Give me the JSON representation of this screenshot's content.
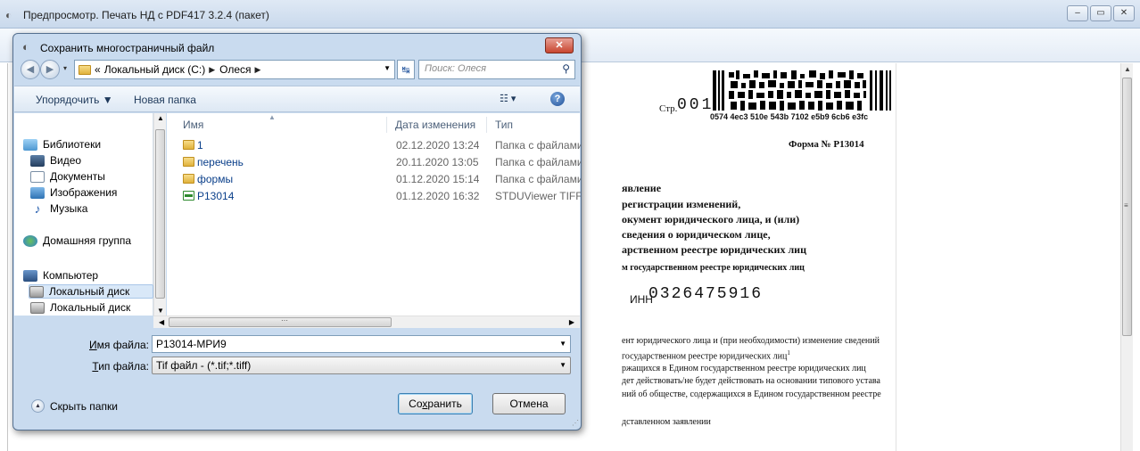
{
  "window": {
    "title": "Предпросмотр. Печать НД с PDF417 3.2.4 (пакет)",
    "minimize": "–",
    "maximize": "▭",
    "close": "✕"
  },
  "document": {
    "page_label": "Стр.",
    "page_number": "001",
    "barcode_text": "0574 4ec3 510e 543b 7102 e5b9 6cb6 e3fc",
    "form_number": "Форма № Р13014",
    "heading_lines": [
      "явление",
      "регистрации изменений,",
      "окумент юридического лица, и (или)",
      "сведения о юридическом лице,",
      "арственном реестре юридических лиц"
    ],
    "subheading": "м государственном реестре юридических лиц",
    "inn_label": "ИНН",
    "inn_value": "0326475916",
    "body_lines": [
      "ент  юридического лица и (при необходимости) изменение сведений",
      "государственном реестре юридических лиц",
      "ржащихся в Едином государственном реестре юридических лиц",
      "дет действовать/не будет действовать на основании типового устава",
      "ний об обществе, содержащихся в Едином государственном реестре",
      "дставленном заявлении"
    ],
    "footnote_mark": "1"
  },
  "dialog": {
    "title": "Сохранить многостраничный файл",
    "close": "✕",
    "nav": {
      "back": "◀",
      "forward": "▶",
      "breadcrumb_prefix": "«",
      "breadcrumbs": [
        "Локальный диск (C:)",
        "Олеся"
      ],
      "search_placeholder": "Поиск: Олеся"
    },
    "toolbar": {
      "organize": "Упорядочить ▼",
      "new_folder": "Новая папка",
      "view": "☷ ▾",
      "help": "?"
    },
    "nav_pane": {
      "items": [
        {
          "label": "Библиотеки",
          "icon": "library-icon"
        },
        {
          "label": "Видео",
          "icon": "video-icon"
        },
        {
          "label": "Документы",
          "icon": "documents-icon"
        },
        {
          "label": "Изображения",
          "icon": "images-icon"
        },
        {
          "label": "Музыка",
          "icon": "music-icon"
        },
        {
          "label": "Домашняя группа",
          "icon": "homegroup-icon"
        },
        {
          "label": "Компьютер",
          "icon": "computer-icon"
        },
        {
          "label": "Локальный диск",
          "icon": "disk-icon"
        },
        {
          "label": "Локальный диск",
          "icon": "disk-icon"
        }
      ]
    },
    "columns": {
      "name": "Имя",
      "date": "Дата изменения",
      "type": "Тип"
    },
    "files": [
      {
        "name": "1",
        "date": "02.12.2020 13:24",
        "type": "Папка с файлами",
        "icon": "folder-icon"
      },
      {
        "name": "перечень",
        "date": "20.11.2020 13:05",
        "type": "Папка с файлами",
        "icon": "folder-icon"
      },
      {
        "name": "формы",
        "date": "01.12.2020 15:14",
        "type": "Папка с файлами",
        "icon": "folder-icon"
      },
      {
        "name": "P13014",
        "date": "01.12.2020 16:32",
        "type": "STDUViewer TIFF ...",
        "icon": "tiff-file-icon"
      }
    ],
    "filename_label_u": "И",
    "filename_label_rest": "мя файла:",
    "filename_value": "P13014-МРИ9",
    "filetype_label_u": "Т",
    "filetype_label_rest": "ип файла:",
    "filetype_value": "Tif файл - (*.tif;*.tiff)",
    "hide_folders": "Скрыть папки",
    "save_button_pre": "Со",
    "save_button_u": "х",
    "save_button_post": "ранить",
    "cancel_button": "Отмена"
  }
}
